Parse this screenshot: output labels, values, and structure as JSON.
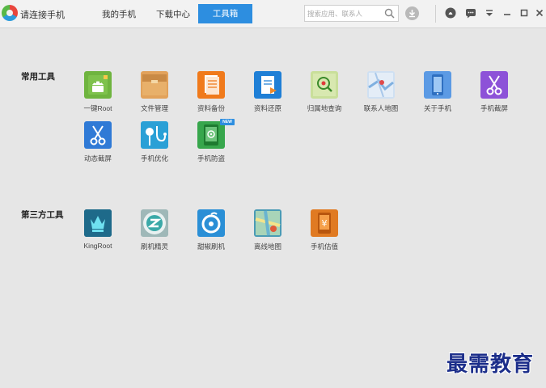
{
  "app": {
    "title": "请连接手机"
  },
  "nav": {
    "my_phone": "我的手机",
    "download_center": "下载中心",
    "toolbox": "工具箱"
  },
  "search": {
    "placeholder": "搜索应用、联系人"
  },
  "sections": {
    "common": {
      "title": "常用工具",
      "items": [
        {
          "label": "一键Root",
          "icon": "android-root-icon",
          "color": "#6fb43f"
        },
        {
          "label": "文件管理",
          "icon": "folder-icon",
          "color": "#e2a25b"
        },
        {
          "label": "资料备份",
          "icon": "document-backup-icon",
          "color": "#f07a1b"
        },
        {
          "label": "资料还原",
          "icon": "document-restore-icon",
          "color": "#1f7fd6"
        },
        {
          "label": "归属地查询",
          "icon": "location-search-icon",
          "color": "#b8d47a"
        },
        {
          "label": "联系人地图",
          "icon": "contact-map-icon",
          "color": "#7fb0e0"
        },
        {
          "label": "关于手机",
          "icon": "phone-info-icon",
          "color": "#4d8fe0"
        },
        {
          "label": "手机截屏",
          "icon": "scissors-icon",
          "color": "#8d52d8"
        },
        {
          "label": "动态截屏",
          "icon": "scissors-dynamic-icon",
          "color": "#2f7ad6"
        },
        {
          "label": "手机优化",
          "icon": "stethoscope-icon",
          "color": "#2aa0d6"
        },
        {
          "label": "手机防盗",
          "icon": "anti-theft-icon",
          "color": "#37a64c"
        }
      ]
    },
    "third_party": {
      "title": "第三方工具",
      "items": [
        {
          "label": "KingRoot",
          "icon": "kingroot-icon",
          "color": "#1a5b7a"
        },
        {
          "label": "刷机精灵",
          "icon": "flash-wizard-icon",
          "color": "#5d8a8a"
        },
        {
          "label": "甜椒刷机",
          "icon": "tianjiao-flash-icon",
          "color": "#2a8fd6"
        },
        {
          "label": "离线地图",
          "icon": "offline-map-icon",
          "color": "#4a9bb5"
        },
        {
          "label": "手机估值",
          "icon": "phone-valuation-icon",
          "color": "#e07a22"
        }
      ]
    }
  },
  "badge": {
    "new": "NEW"
  },
  "watermark": "最需教育"
}
